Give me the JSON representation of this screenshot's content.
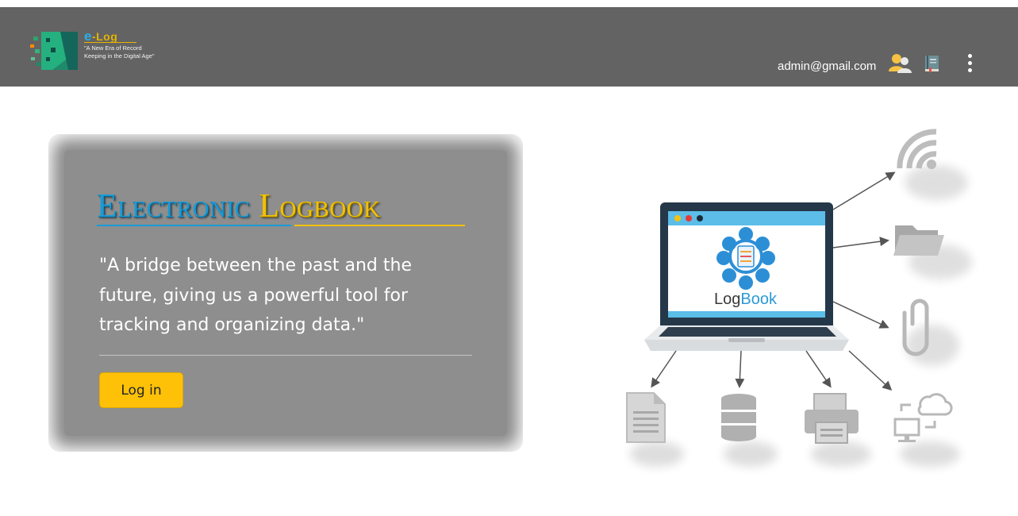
{
  "header": {
    "brand": {
      "title_e": "e",
      "title_rest": "-Log",
      "tagline": "\"A New Era of Record Keeping in the Digital Age\""
    },
    "user_email": "admin@gmail.com",
    "icons": [
      "users-icon",
      "logbook-icon",
      "more-vertical-icon"
    ]
  },
  "hero": {
    "title_part1": "Electronic",
    "title_part2": "Logbook",
    "quote": "\"A bridge between the past and the future, giving us a powerful tool for tracking and organizing data.\"",
    "login_label": "Log in"
  },
  "illustration": {
    "screen_brand_part1": "Log",
    "screen_brand_part2": "Book",
    "icons": [
      "wifi-icon",
      "folder-icon",
      "paperclip-icon",
      "document-icon",
      "database-icon",
      "printer-icon",
      "cloud-sync-icon"
    ]
  },
  "colors": {
    "navbar": "#636363",
    "card": "#8d8e8d",
    "accent_blue": "#1a9bd6",
    "accent_gold": "#f2c200",
    "button": "#ffc107"
  }
}
